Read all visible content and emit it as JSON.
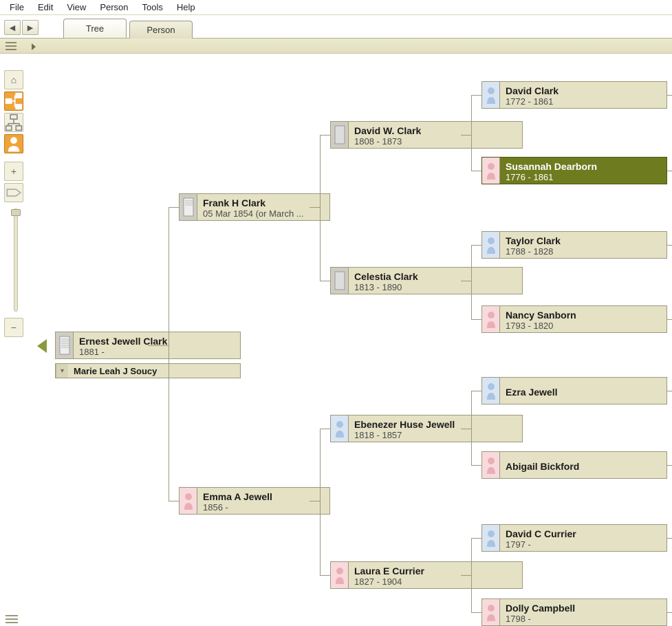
{
  "menu": {
    "items": [
      "File",
      "Edit",
      "View",
      "Person",
      "Tools",
      "Help"
    ]
  },
  "nav": {
    "back_glyph": "◀",
    "fwd_glyph": "▶"
  },
  "tabs": {
    "tree": "Tree",
    "person": "Person",
    "active": "tree"
  },
  "palette": {
    "home": "⌂",
    "pedigree": "▭",
    "descend": "▽",
    "person": "👤",
    "plus": "+",
    "tag": "⬠",
    "minus": "−"
  },
  "people": {
    "root": {
      "name": "Ernest Jewell Clark",
      "dates": "1881 -"
    },
    "spouse": {
      "name": "Marie Leah J Soucy"
    },
    "father": {
      "name": "Frank H Clark",
      "dates": "05 Mar 1854 (or March ..."
    },
    "mother": {
      "name": "Emma A Jewell",
      "dates": "1856 -"
    },
    "pgp_f": {
      "name": "David W. Clark",
      "dates": "1808 - 1873"
    },
    "pgp_m": {
      "name": "Celestia Clark",
      "dates": "1813 - 1890"
    },
    "mgp_f": {
      "name": "Ebenezer Huse Jewell",
      "dates": "1818 - 1857"
    },
    "mgp_m": {
      "name": "Laura E Currier",
      "dates": "1827 - 1904"
    },
    "g1": {
      "name": "David Clark",
      "dates": "1772 - 1861"
    },
    "g2": {
      "name": "Susannah Dearborn",
      "dates": "1776 - 1861"
    },
    "g3": {
      "name": "Taylor Clark",
      "dates": "1788 - 1828"
    },
    "g4": {
      "name": "Nancy Sanborn",
      "dates": "1793 - 1820"
    },
    "g5": {
      "name": "Ezra Jewell",
      "dates": ""
    },
    "g6": {
      "name": "Abigail Bickford",
      "dates": ""
    },
    "g7": {
      "name": "David C Currier",
      "dates": "1797 -"
    },
    "g8": {
      "name": "Dolly Campbell",
      "dates": "1798 -"
    }
  },
  "selected_person": "g2"
}
